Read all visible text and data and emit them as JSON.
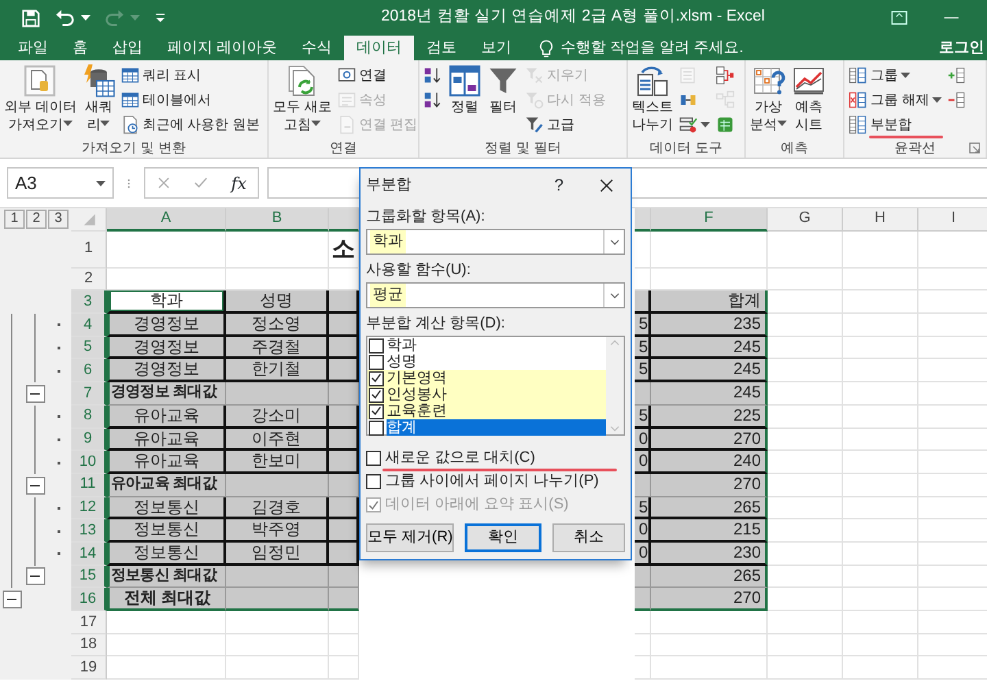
{
  "title_bar": {
    "title": "2018년 컴활 실기 연습예제 2급 A형 풀이.xlsm - Excel"
  },
  "ribbon_tabs": [
    {
      "label": "파일",
      "selected": false
    },
    {
      "label": "홈",
      "selected": false
    },
    {
      "label": "삽입",
      "selected": false
    },
    {
      "label": "페이지 레이아웃",
      "selected": false
    },
    {
      "label": "수식",
      "selected": false
    },
    {
      "label": "데이터",
      "selected": true
    },
    {
      "label": "검토",
      "selected": false
    },
    {
      "label": "보기",
      "selected": false
    }
  ],
  "tell_me": "수행할 작업을 알려 주세요.",
  "sign_in": "로그인",
  "ribbon_groups": [
    {
      "label": "가져오기 및 변환",
      "columns": [
        {
          "kind": "large",
          "lines": [
            "외부 데이터",
            "가져오기"
          ],
          "dropdown": true,
          "disabled": false
        },
        {
          "kind": "large",
          "lines": [
            "새쿼",
            "리"
          ],
          "dropdown": true,
          "disabled": false
        },
        {
          "kind": "stack",
          "items": [
            {
              "label": "쿼리 표시",
              "disabled": false,
              "dropdown": false
            },
            {
              "label": "테이블에서",
              "disabled": false,
              "dropdown": false
            },
            {
              "label": "최근에 사용한 원본",
              "disabled": false,
              "dropdown": false
            }
          ]
        }
      ]
    },
    {
      "label": "연결",
      "columns": [
        {
          "kind": "large",
          "lines": [
            "모두 새로",
            "고침"
          ],
          "dropdown": true,
          "disabled": false
        },
        {
          "kind": "stack",
          "items": [
            {
              "label": "연결",
              "disabled": false,
              "dropdown": false
            },
            {
              "label": "속성",
              "disabled": true,
              "dropdown": false
            },
            {
              "label": "연결 편집",
              "disabled": true,
              "dropdown": false
            }
          ]
        }
      ]
    },
    {
      "label": "정렬 및 필터",
      "columns": [
        {
          "kind": "stack",
          "items": [
            {
              "disabled": false,
              "dropdown": false
            },
            {
              "disabled": false,
              "dropdown": false
            }
          ]
        },
        {
          "kind": "large",
          "lines": [
            "정렬"
          ],
          "dropdown": false,
          "disabled": false
        },
        {
          "kind": "large",
          "lines": [
            "필터"
          ],
          "dropdown": false,
          "disabled": false
        },
        {
          "kind": "stack",
          "items": [
            {
              "label": "지우기",
              "disabled": true,
              "dropdown": false
            },
            {
              "label": "다시 적용",
              "disabled": true,
              "dropdown": false
            },
            {
              "label": "고급",
              "disabled": false,
              "dropdown": false
            }
          ]
        }
      ]
    },
    {
      "label": "데이터 도구",
      "columns": [
        {
          "kind": "large",
          "lines": [
            "텍스트",
            "나누기"
          ],
          "dropdown": false,
          "disabled": false
        },
        {
          "kind": "stack",
          "items": [
            {
              "disabled": true,
              "dropdown": false
            },
            {
              "disabled": false,
              "dropdown": false
            },
            {
              "disabled": false,
              "dropdown": true
            }
          ]
        },
        {
          "kind": "stack",
          "items": [
            {
              "disabled": false,
              "dropdown": false
            },
            {
              "disabled": true,
              "dropdown": false
            },
            {
              "disabled": false,
              "dropdown": false
            }
          ]
        }
      ]
    },
    {
      "label": "예측",
      "columns": [
        {
          "kind": "large",
          "lines": [
            "가상",
            "분석"
          ],
          "dropdown": true,
          "disabled": false
        },
        {
          "kind": "large",
          "lines": [
            "예측",
            "시트"
          ],
          "dropdown": false,
          "disabled": false
        }
      ]
    },
    {
      "label": "윤곽선",
      "launcher": true,
      "columns": [
        {
          "kind": "stack",
          "items": [
            {
              "label": "그룹",
              "disabled": false,
              "dropdown": true,
              "annotated": false
            },
            {
              "label": "그룹 해제",
              "disabled": false,
              "dropdown": true,
              "annotated": false
            },
            {
              "label": "부분합",
              "disabled": false,
              "dropdown": false,
              "annotated": true
            }
          ]
        },
        {
          "kind": "stack",
          "items": [
            {
              "disabled": false,
              "dropdown": false
            },
            {
              "disabled": false,
              "dropdown": false
            }
          ]
        }
      ]
    }
  ],
  "formula_bar": {
    "name_box": "A3",
    "function_label": "fx"
  },
  "sheet": {
    "outline_levels": [
      "1",
      "2",
      "3"
    ],
    "columns": {
      "A": {
        "label": "A",
        "selected": true
      },
      "B": {
        "label": "B",
        "selected": true
      },
      "C": {
        "selected": true
      },
      "E": {
        "selected": true
      },
      "F": {
        "label": "F",
        "selected": true
      },
      "G": {
        "label": "G",
        "selected": false
      },
      "H": {
        "label": "H",
        "selected": false
      },
      "I": {
        "label": "I",
        "selected": false
      }
    },
    "rows": [
      {
        "number": "1",
        "kind": "title",
        "selected": false,
        "cells": {
          "C": {
            "text": "소",
            "active": false
          }
        }
      },
      {
        "number": "2",
        "kind": "blank",
        "selected": false
      },
      {
        "number": "3",
        "kind": "header",
        "selected": true,
        "cells": {
          "A": {
            "text": "학과",
            "active": true
          },
          "B": {
            "text": "성명",
            "active": false
          },
          "F": {
            "text": "합계",
            "active": false
          }
        }
      },
      {
        "number": "4",
        "kind": "detail",
        "selected": true,
        "outline": {
          "kind": "detail"
        },
        "cells": {
          "A": {
            "text": "경영정보",
            "active": false
          },
          "B": {
            "text": "정소영",
            "active": false
          },
          "E": {
            "text": "5",
            "active": false
          },
          "F": {
            "text": "235",
            "active": false
          }
        }
      },
      {
        "number": "5",
        "kind": "detail",
        "selected": true,
        "outline": {
          "kind": "detail"
        },
        "cells": {
          "A": {
            "text": "경영정보",
            "active": false
          },
          "B": {
            "text": "주경철",
            "active": false
          },
          "E": {
            "text": "5",
            "active": false
          },
          "F": {
            "text": "245",
            "active": false
          }
        }
      },
      {
        "number": "6",
        "kind": "detail",
        "selected": true,
        "outline": {
          "kind": "detail"
        },
        "cells": {
          "A": {
            "text": "경영정보",
            "active": false
          },
          "B": {
            "text": "한기철",
            "active": false
          },
          "E": {
            "text": "5",
            "active": false
          },
          "F": {
            "text": "245",
            "active": false
          }
        }
      },
      {
        "number": "7",
        "kind": "subtotal",
        "selected": true,
        "outline": {
          "kind": "group_end"
        },
        "cells": {
          "A": {
            "text": "경영정보 최대값",
            "active": false
          },
          "F": {
            "text": "245",
            "active": false
          }
        }
      },
      {
        "number": "8",
        "kind": "detail",
        "selected": true,
        "outline": {
          "kind": "detail"
        },
        "cells": {
          "A": {
            "text": "유아교육",
            "active": false
          },
          "B": {
            "text": "강소미",
            "active": false
          },
          "E": {
            "text": "5",
            "active": false
          },
          "F": {
            "text": "225",
            "active": false
          }
        }
      },
      {
        "number": "9",
        "kind": "detail",
        "selected": true,
        "outline": {
          "kind": "detail"
        },
        "cells": {
          "A": {
            "text": "유아교육",
            "active": false
          },
          "B": {
            "text": "이주현",
            "active": false
          },
          "E": {
            "text": "0",
            "active": false
          },
          "F": {
            "text": "270",
            "active": false
          }
        }
      },
      {
        "number": "10",
        "kind": "detail",
        "selected": true,
        "outline": {
          "kind": "detail"
        },
        "cells": {
          "A": {
            "text": "유아교육",
            "active": false
          },
          "B": {
            "text": "한보미",
            "active": false
          },
          "E": {
            "text": "0",
            "active": false
          },
          "F": {
            "text": "240",
            "active": false
          }
        }
      },
      {
        "number": "11",
        "kind": "subtotal",
        "selected": true,
        "outline": {
          "kind": "group_end"
        },
        "cells": {
          "A": {
            "text": "유아교육 최대값",
            "active": false
          },
          "F": {
            "text": "270",
            "active": false
          }
        }
      },
      {
        "number": "12",
        "kind": "detail",
        "selected": true,
        "outline": {
          "kind": "detail"
        },
        "cells": {
          "A": {
            "text": "정보통신",
            "active": false
          },
          "B": {
            "text": "김경호",
            "active": false
          },
          "E": {
            "text": "5",
            "active": false
          },
          "F": {
            "text": "265",
            "active": false
          }
        }
      },
      {
        "number": "13",
        "kind": "detail",
        "selected": true,
        "outline": {
          "kind": "detail"
        },
        "cells": {
          "A": {
            "text": "정보통신",
            "active": false
          },
          "B": {
            "text": "박주영",
            "active": false
          },
          "E": {
            "text": "0",
            "active": false
          },
          "F": {
            "text": "215",
            "active": false
          }
        }
      },
      {
        "number": "14",
        "kind": "detail",
        "selected": true,
        "outline": {
          "kind": "detail"
        },
        "cells": {
          "A": {
            "text": "정보통신",
            "active": false
          },
          "B": {
            "text": "임정민",
            "active": false
          },
          "E": {
            "text": "0",
            "active": false
          },
          "F": {
            "text": "230",
            "active": false
          }
        }
      },
      {
        "number": "15",
        "kind": "subtotal",
        "selected": true,
        "outline": {
          "kind": "group_end"
        },
        "cells": {
          "A": {
            "text": "정보통신 최대값",
            "active": false
          },
          "F": {
            "text": "265",
            "active": false
          }
        }
      },
      {
        "number": "16",
        "kind": "total",
        "selected": true,
        "outline": {
          "kind": "total_end"
        },
        "cells": {
          "A": {
            "text": "전체 최대값",
            "active": false
          },
          "F": {
            "text": "270",
            "active": false
          }
        }
      },
      {
        "number": "17",
        "kind": "blank",
        "selected": false
      },
      {
        "number": "18",
        "kind": "blank",
        "selected": false
      },
      {
        "number": "19",
        "kind": "blank",
        "selected": false
      }
    ]
  },
  "dialog": {
    "title": "부분합",
    "help": "?",
    "fields": [
      {
        "label": "그룹화할 항목(A):",
        "value": "학과",
        "highlighted": true
      },
      {
        "label": "사용할 함수(U):",
        "value": "평균",
        "highlighted": true
      }
    ],
    "list_label": "부분합 계산 항목(D):",
    "list_items": [
      {
        "label": "학과",
        "checked": false,
        "selected": false,
        "highlighted": false
      },
      {
        "label": "성명",
        "checked": false,
        "selected": false,
        "highlighted": false
      },
      {
        "label": "기본영역",
        "checked": true,
        "selected": false,
        "highlighted": true
      },
      {
        "label": "인성봉사",
        "checked": true,
        "selected": false,
        "highlighted": true
      },
      {
        "label": "교육훈련",
        "checked": true,
        "selected": false,
        "highlighted": true
      },
      {
        "label": "합계",
        "checked": false,
        "selected": true,
        "highlighted": false
      }
    ],
    "options": [
      {
        "label": "새로운 값으로 대치(C)",
        "checked": false,
        "disabled": false,
        "annotated": true
      },
      {
        "label": "그룹 사이에서 페이지 나누기(P)",
        "checked": false,
        "disabled": false,
        "annotated": false
      },
      {
        "label": "데이터 아래에 요약 표시(S)",
        "checked": true,
        "disabled": true,
        "annotated": false
      }
    ],
    "buttons": [
      {
        "label": "모두 제거(R)",
        "default": false
      },
      {
        "label": "확인",
        "default": true
      },
      {
        "label": "취소",
        "default": false
      }
    ]
  }
}
